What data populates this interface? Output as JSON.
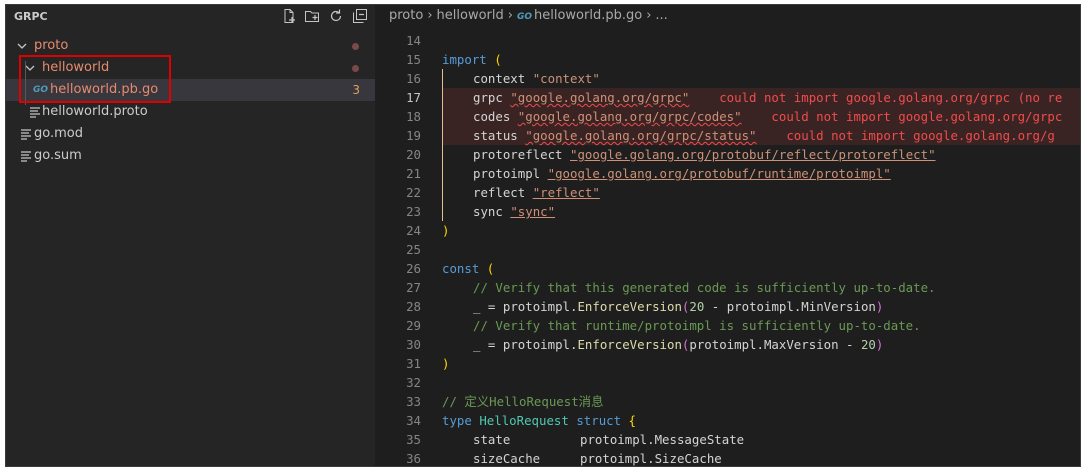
{
  "explorer": {
    "title": "GRPC",
    "tree": [
      {
        "label": "proto",
        "kind": "folder"
      },
      {
        "label": "helloworld",
        "kind": "folder"
      },
      {
        "label": "helloworld.pb.go",
        "kind": "go-file",
        "problems": "3"
      },
      {
        "label": "helloworld.proto",
        "kind": "file"
      },
      {
        "label": "go.mod",
        "kind": "file"
      },
      {
        "label": "go.sum",
        "kind": "file"
      }
    ],
    "go_icon_text": "GO"
  },
  "breadcrumb": [
    "proto",
    "helloworld",
    "helloworld.pb.go",
    "..."
  ],
  "editor": {
    "line_numbers": [
      "14",
      "15",
      "16",
      "17",
      "18",
      "19",
      "20",
      "21",
      "22",
      "23",
      "24",
      "25",
      "26",
      "27",
      "28",
      "29",
      "30",
      "31",
      "32",
      "33",
      "34",
      "35",
      "36"
    ],
    "active_line": "17",
    "errors": {
      "grpc": "could not import google.golang.org/grpc (no re",
      "codes": "could not import google.golang.org/grpc",
      "status": "could not import google.golang.org/g"
    },
    "tokens": {
      "import": "import",
      "const": "const",
      "type": "type",
      "struct": "struct",
      "context_id": "context",
      "context_str": "\"context\"",
      "grpc_id": "grpc",
      "grpc_str": "\"google.golang.org/grpc\"",
      "codes_id": "codes",
      "codes_str": "\"google.golang.org/grpc/codes\"",
      "status_id": "status",
      "status_str": "\"google.golang.org/grpc/status\"",
      "protoreflect_id": "protoreflect",
      "protoreflect_str": "\"google.golang.org/protobuf/reflect/protoreflect\"",
      "protoimpl_id": "protoimpl",
      "protoimpl_str": "\"google.golang.org/protobuf/runtime/protoimpl\"",
      "reflect_id": "reflect",
      "reflect_str": "\"reflect\"",
      "sync_id": "sync",
      "sync_str": "\"sync\"",
      "comment1": "// Verify that this generated code is sufficiently up-to-date.",
      "comment2": "// Verify that runtime/protoimpl is sufficiently up-to-date.",
      "underscore": "_",
      "eq": " = ",
      "protoimpl_dot": "protoimpl.",
      "enforce": "EnforceVersion",
      "num20": "20",
      "minus": " - ",
      "minver": "protoimpl.MinVersion",
      "maxver": "protoimpl.MaxVersion",
      "comment3": "// 定义HelloRequest消息",
      "hello_request": "HelloRequest",
      "state_id": "state",
      "state_type": "protoimpl.MessageState",
      "sizecache_id": "sizeCache",
      "sizecache_type": "protoimpl.SizeCache",
      "open_paren": "(",
      "close_paren": ")",
      "open_brace": "{"
    }
  }
}
